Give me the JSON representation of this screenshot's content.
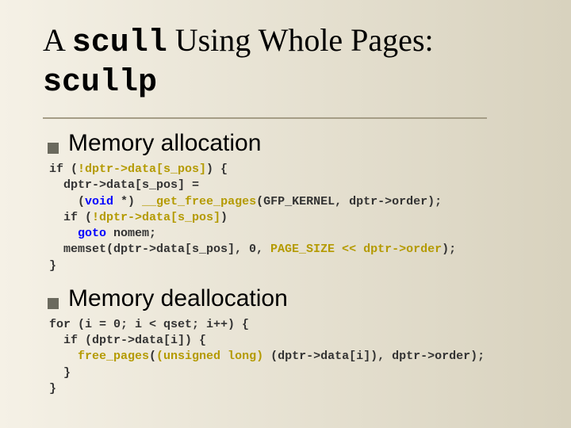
{
  "title": {
    "pre": "A ",
    "code1": "scull",
    "mid": " Using Whole Pages: ",
    "code2": "scullp"
  },
  "sections": [
    {
      "heading": "Memory allocation",
      "code_lines": [
        [
          {
            "t": "if (",
            "c": ""
          },
          {
            "t": "!dptr->data[s_pos]",
            "c": "hl"
          },
          {
            "t": ") {",
            "c": ""
          }
        ],
        [
          {
            "t": "  dptr->data[s_pos] =",
            "c": ""
          }
        ],
        [
          {
            "t": "    (",
            "c": ""
          },
          {
            "t": "void",
            "c": "kw"
          },
          {
            "t": " *) ",
            "c": ""
          },
          {
            "t": "__get_free_pages",
            "c": "hl"
          },
          {
            "t": "(GFP_KERNEL, dptr->order);",
            "c": ""
          }
        ],
        [
          {
            "t": "  if (",
            "c": ""
          },
          {
            "t": "!dptr->data[s_pos]",
            "c": "hl"
          },
          {
            "t": ")",
            "c": ""
          }
        ],
        [
          {
            "t": "    ",
            "c": ""
          },
          {
            "t": "goto",
            "c": "kw"
          },
          {
            "t": " nomem;",
            "c": ""
          }
        ],
        [
          {
            "t": "  memset(dptr->data[s_pos], 0, ",
            "c": ""
          },
          {
            "t": "PAGE_SIZE << dptr->order",
            "c": "hl"
          },
          {
            "t": ");",
            "c": ""
          }
        ],
        [
          {
            "t": "}",
            "c": ""
          }
        ]
      ]
    },
    {
      "heading": "Memory deallocation",
      "code_lines": [
        [
          {
            "t": "for (i = 0; i < qset; i++) {",
            "c": ""
          }
        ],
        [
          {
            "t": "  if (dptr->data[i]) {",
            "c": ""
          }
        ],
        [
          {
            "t": "    ",
            "c": ""
          },
          {
            "t": "free_pages",
            "c": "hl"
          },
          {
            "t": "(",
            "c": ""
          },
          {
            "t": "(unsigned long)",
            "c": "hl"
          },
          {
            "t": " (dptr->data[i]), dptr->order);",
            "c": ""
          }
        ],
        [
          {
            "t": "  }",
            "c": ""
          }
        ],
        [
          {
            "t": "}",
            "c": ""
          }
        ]
      ]
    }
  ]
}
